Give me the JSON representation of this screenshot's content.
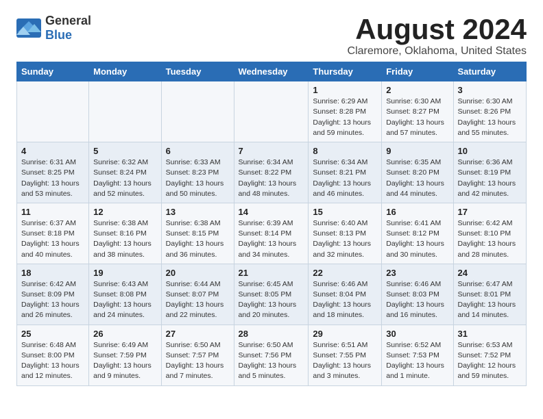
{
  "logo": {
    "text_general": "General",
    "text_blue": "Blue"
  },
  "title": "August 2024",
  "subtitle": "Claremore, Oklahoma, United States",
  "days_of_week": [
    "Sunday",
    "Monday",
    "Tuesday",
    "Wednesday",
    "Thursday",
    "Friday",
    "Saturday"
  ],
  "weeks": [
    [
      {
        "day": "",
        "info": ""
      },
      {
        "day": "",
        "info": ""
      },
      {
        "day": "",
        "info": ""
      },
      {
        "day": "",
        "info": ""
      },
      {
        "day": "1",
        "info": "Sunrise: 6:29 AM\nSunset: 8:28 PM\nDaylight: 13 hours\nand 59 minutes."
      },
      {
        "day": "2",
        "info": "Sunrise: 6:30 AM\nSunset: 8:27 PM\nDaylight: 13 hours\nand 57 minutes."
      },
      {
        "day": "3",
        "info": "Sunrise: 6:30 AM\nSunset: 8:26 PM\nDaylight: 13 hours\nand 55 minutes."
      }
    ],
    [
      {
        "day": "4",
        "info": "Sunrise: 6:31 AM\nSunset: 8:25 PM\nDaylight: 13 hours\nand 53 minutes."
      },
      {
        "day": "5",
        "info": "Sunrise: 6:32 AM\nSunset: 8:24 PM\nDaylight: 13 hours\nand 52 minutes."
      },
      {
        "day": "6",
        "info": "Sunrise: 6:33 AM\nSunset: 8:23 PM\nDaylight: 13 hours\nand 50 minutes."
      },
      {
        "day": "7",
        "info": "Sunrise: 6:34 AM\nSunset: 8:22 PM\nDaylight: 13 hours\nand 48 minutes."
      },
      {
        "day": "8",
        "info": "Sunrise: 6:34 AM\nSunset: 8:21 PM\nDaylight: 13 hours\nand 46 minutes."
      },
      {
        "day": "9",
        "info": "Sunrise: 6:35 AM\nSunset: 8:20 PM\nDaylight: 13 hours\nand 44 minutes."
      },
      {
        "day": "10",
        "info": "Sunrise: 6:36 AM\nSunset: 8:19 PM\nDaylight: 13 hours\nand 42 minutes."
      }
    ],
    [
      {
        "day": "11",
        "info": "Sunrise: 6:37 AM\nSunset: 8:18 PM\nDaylight: 13 hours\nand 40 minutes."
      },
      {
        "day": "12",
        "info": "Sunrise: 6:38 AM\nSunset: 8:16 PM\nDaylight: 13 hours\nand 38 minutes."
      },
      {
        "day": "13",
        "info": "Sunrise: 6:38 AM\nSunset: 8:15 PM\nDaylight: 13 hours\nand 36 minutes."
      },
      {
        "day": "14",
        "info": "Sunrise: 6:39 AM\nSunset: 8:14 PM\nDaylight: 13 hours\nand 34 minutes."
      },
      {
        "day": "15",
        "info": "Sunrise: 6:40 AM\nSunset: 8:13 PM\nDaylight: 13 hours\nand 32 minutes."
      },
      {
        "day": "16",
        "info": "Sunrise: 6:41 AM\nSunset: 8:12 PM\nDaylight: 13 hours\nand 30 minutes."
      },
      {
        "day": "17",
        "info": "Sunrise: 6:42 AM\nSunset: 8:10 PM\nDaylight: 13 hours\nand 28 minutes."
      }
    ],
    [
      {
        "day": "18",
        "info": "Sunrise: 6:42 AM\nSunset: 8:09 PM\nDaylight: 13 hours\nand 26 minutes."
      },
      {
        "day": "19",
        "info": "Sunrise: 6:43 AM\nSunset: 8:08 PM\nDaylight: 13 hours\nand 24 minutes."
      },
      {
        "day": "20",
        "info": "Sunrise: 6:44 AM\nSunset: 8:07 PM\nDaylight: 13 hours\nand 22 minutes."
      },
      {
        "day": "21",
        "info": "Sunrise: 6:45 AM\nSunset: 8:05 PM\nDaylight: 13 hours\nand 20 minutes."
      },
      {
        "day": "22",
        "info": "Sunrise: 6:46 AM\nSunset: 8:04 PM\nDaylight: 13 hours\nand 18 minutes."
      },
      {
        "day": "23",
        "info": "Sunrise: 6:46 AM\nSunset: 8:03 PM\nDaylight: 13 hours\nand 16 minutes."
      },
      {
        "day": "24",
        "info": "Sunrise: 6:47 AM\nSunset: 8:01 PM\nDaylight: 13 hours\nand 14 minutes."
      }
    ],
    [
      {
        "day": "25",
        "info": "Sunrise: 6:48 AM\nSunset: 8:00 PM\nDaylight: 13 hours\nand 12 minutes."
      },
      {
        "day": "26",
        "info": "Sunrise: 6:49 AM\nSunset: 7:59 PM\nDaylight: 13 hours\nand 9 minutes."
      },
      {
        "day": "27",
        "info": "Sunrise: 6:50 AM\nSunset: 7:57 PM\nDaylight: 13 hours\nand 7 minutes."
      },
      {
        "day": "28",
        "info": "Sunrise: 6:50 AM\nSunset: 7:56 PM\nDaylight: 13 hours\nand 5 minutes."
      },
      {
        "day": "29",
        "info": "Sunrise: 6:51 AM\nSunset: 7:55 PM\nDaylight: 13 hours\nand 3 minutes."
      },
      {
        "day": "30",
        "info": "Sunrise: 6:52 AM\nSunset: 7:53 PM\nDaylight: 13 hours\nand 1 minute."
      },
      {
        "day": "31",
        "info": "Sunrise: 6:53 AM\nSunset: 7:52 PM\nDaylight: 12 hours\nand 59 minutes."
      }
    ]
  ]
}
